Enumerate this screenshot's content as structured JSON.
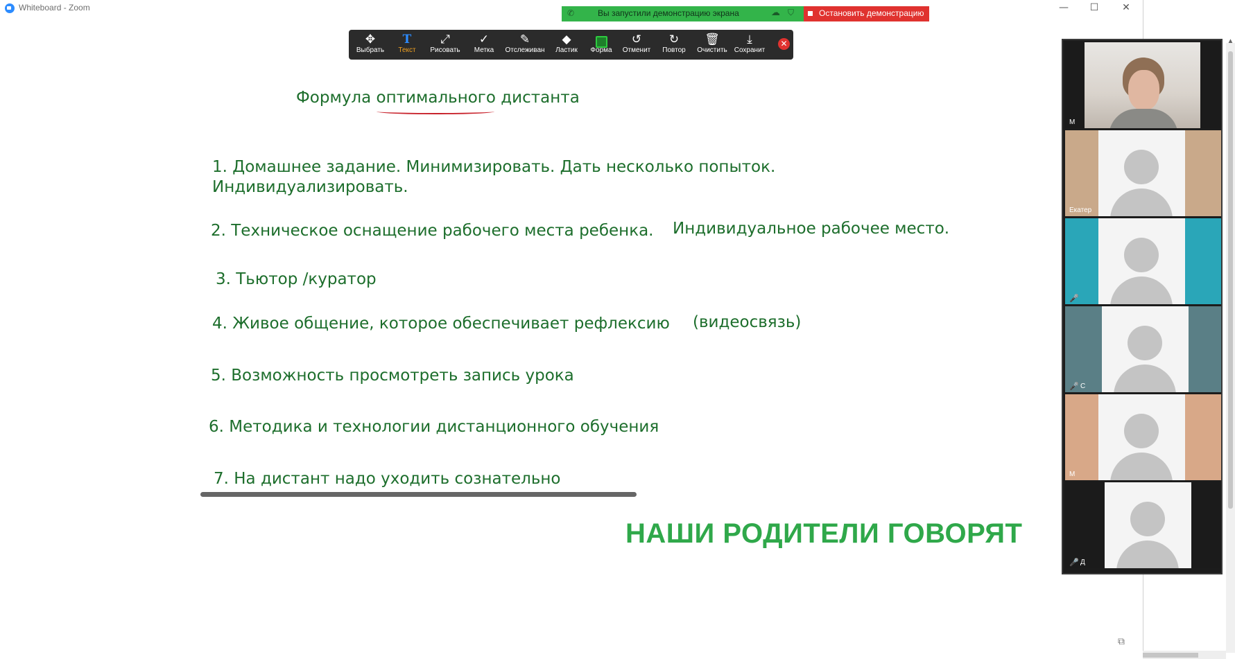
{
  "window": {
    "title": "Whiteboard - Zoom",
    "min_glyph": "—",
    "max_glyph": "☐",
    "close_glyph": "✕"
  },
  "share_banner": {
    "text": "Вы запустили демонстрацию экрана",
    "stop_label": "Остановить демонстрацию",
    "colors": {
      "banner": "#33b44a",
      "stop": "#e0322f"
    }
  },
  "toolbar": {
    "tools": [
      {
        "label": "Выбрать",
        "icon": "move-icon",
        "glyph": "✥"
      },
      {
        "label": "Текст",
        "icon": "text-icon",
        "glyph": "T",
        "active": true
      },
      {
        "label": "Рисовать",
        "icon": "draw-icon",
        "glyph": "⤢"
      },
      {
        "label": "Метка",
        "icon": "stamp-icon",
        "glyph": "✓"
      },
      {
        "label": "Отслеживан",
        "icon": "spotlight-icon",
        "glyph": "✎"
      },
      {
        "label": "Ластик",
        "icon": "eraser-icon",
        "glyph": "◆"
      },
      {
        "label": "Форма",
        "icon": "format-icon",
        "glyph": ""
      },
      {
        "label": "Отменит",
        "icon": "undo-icon",
        "glyph": "↺"
      },
      {
        "label": "Повтор",
        "icon": "redo-icon",
        "glyph": "↻"
      },
      {
        "label": "Очистить",
        "icon": "trash-icon",
        "glyph": "🗑"
      },
      {
        "label": "Сохранит",
        "icon": "save-icon",
        "glyph": "⤓"
      }
    ],
    "close_glyph": "✕"
  },
  "whiteboard": {
    "title": "Формула оптимального дистанта",
    "item1_line1": "1. Домашнее задание. Минимизировать. Дать несколько попыток.",
    "item1_line2": "Индивидуализировать.",
    "item2": "2. Техническое оснащение рабочего места ребенка.",
    "item2_extra": "Индивидуальное рабочее место.",
    "item3": "3. Тьютор /куратор",
    "item4": "4. Живое общение, которое обеспечивает рефлексию",
    "item4_extra": "(видеосвязь)",
    "item5": "5. Возможность просмотреть запись урока",
    "item6": "6. Методика и технологии дистанционного обучения",
    "item7": "7. На дистант надо уходить сознательно",
    "headline": "НАШИ РОДИТЕЛИ ГОВОРЯТ",
    "text_color": "#1d6e2c",
    "headline_color": "#2fa84a"
  },
  "gallery": {
    "tiles": [
      {
        "type": "video",
        "name": "М"
      },
      {
        "type": "avatar",
        "name": "Екатер"
      },
      {
        "type": "avatar",
        "name": "",
        "muted": true
      },
      {
        "type": "avatar",
        "name": "С",
        "muted": true
      },
      {
        "type": "avatar",
        "name": "М"
      },
      {
        "type": "avatar",
        "name": "Д",
        "muted": true
      }
    ]
  }
}
